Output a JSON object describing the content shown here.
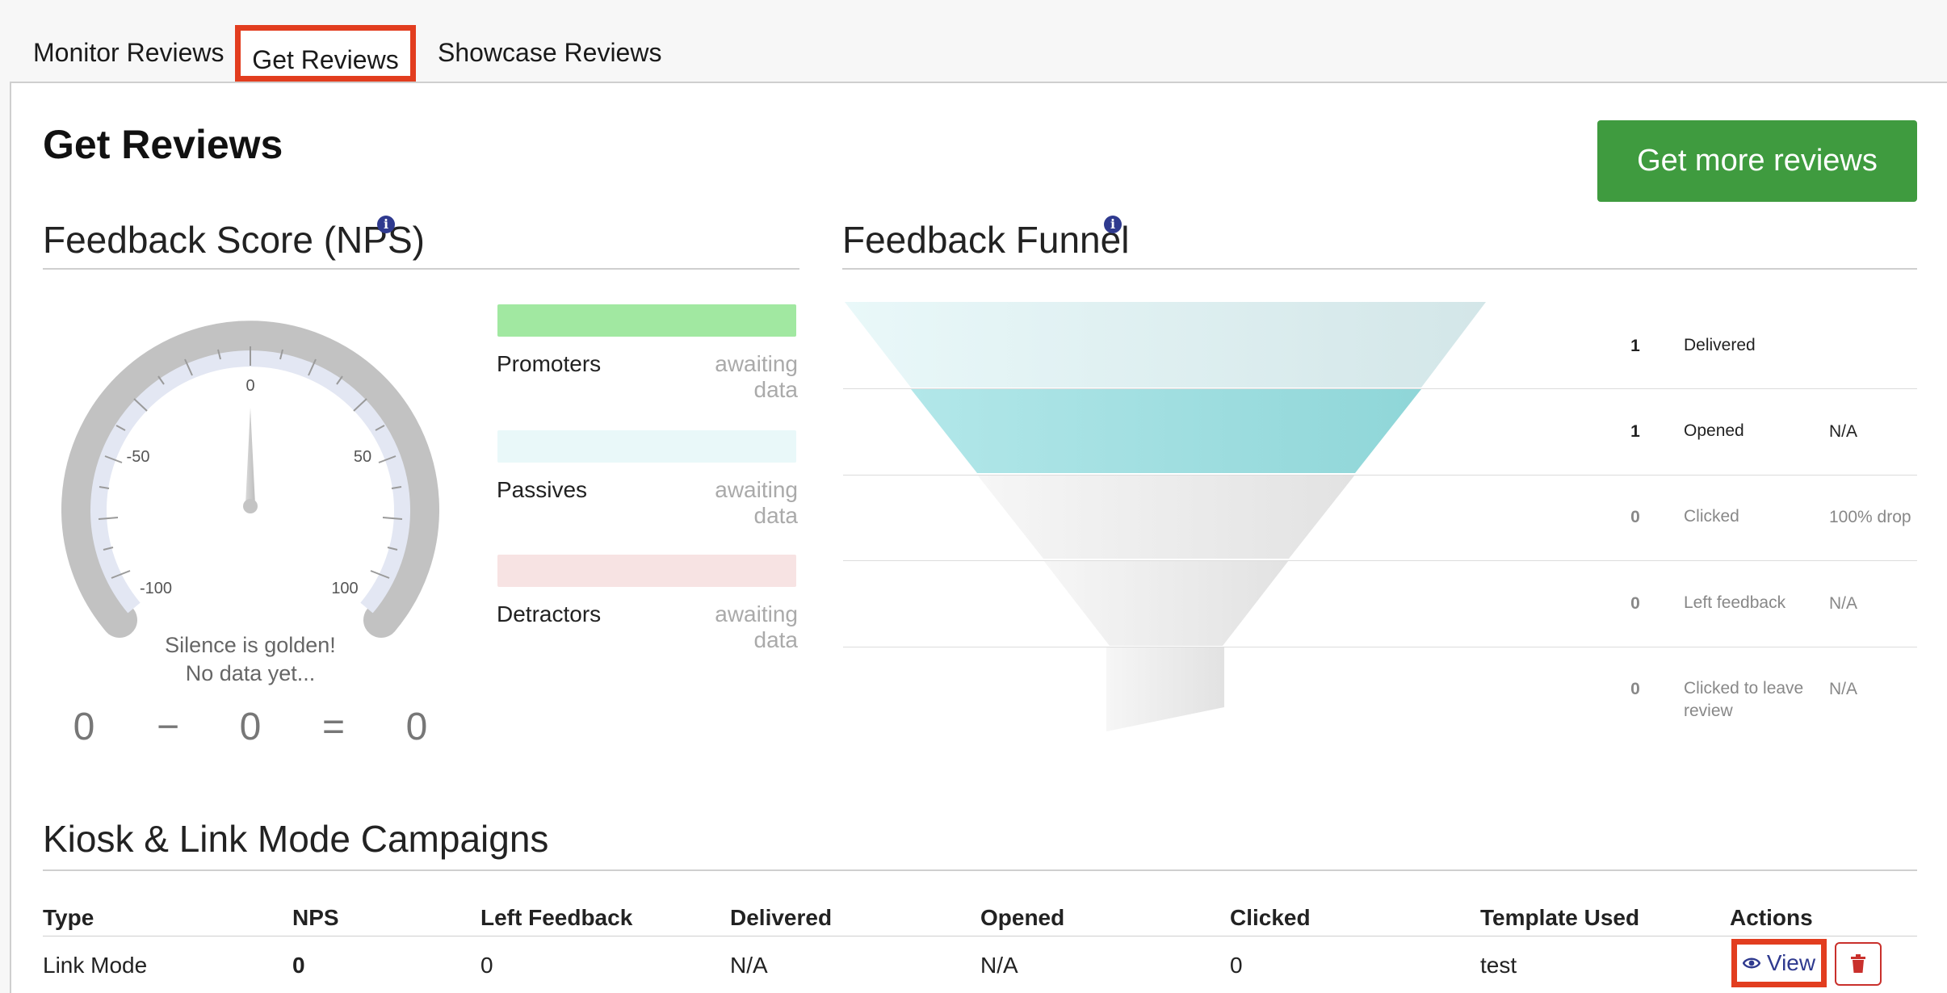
{
  "tabs": [
    {
      "label": "Monitor Reviews"
    },
    {
      "label": "Get Reviews"
    },
    {
      "label": "Showcase Reviews"
    }
  ],
  "page": {
    "title": "Get Reviews",
    "cta_label": "Get more reviews"
  },
  "nps": {
    "title": "Feedback Score (NPS)",
    "gauge_ticks": [
      "0",
      "-50",
      "50",
      "-100",
      "100"
    ],
    "empty_line1": "Silence is golden!",
    "empty_line2": "No data yet...",
    "equation": {
      "a": "0",
      "minus": "−",
      "b": "0",
      "equals": "=",
      "result": "0"
    },
    "legend": [
      {
        "label": "Promoters",
        "status": "awaiting data",
        "color": "#a1e8a1"
      },
      {
        "label": "Passives",
        "status": "awaiting data",
        "color": "#e9f8f9"
      },
      {
        "label": "Detractors",
        "status": "awaiting data",
        "color": "#f7e3e3"
      }
    ]
  },
  "funnel": {
    "title": "Feedback Funnel",
    "rows": [
      {
        "count": "1",
        "label": "Delivered",
        "pct": ""
      },
      {
        "count": "1",
        "label": "Opened",
        "pct": "N/A"
      },
      {
        "count": "0",
        "label": "Clicked",
        "pct": "100% drop"
      },
      {
        "count": "0",
        "label": "Left feedback",
        "pct": "N/A"
      },
      {
        "count": "0",
        "label_line1": "Clicked to leave",
        "label_line2": "review",
        "pct": "N/A"
      }
    ]
  },
  "campaigns": {
    "title": "Kiosk & Link Mode Campaigns",
    "headers": [
      "Type",
      "NPS",
      "Left Feedback",
      "Delivered",
      "Opened",
      "Clicked",
      "Template Used",
      "Actions"
    ],
    "rows": [
      {
        "type": "Link Mode",
        "nps": "0",
        "left_feedback": "0",
        "delivered": "N/A",
        "opened": "N/A",
        "clicked": "0",
        "template": "test",
        "view_label": "View"
      }
    ]
  },
  "icons": {
    "info": "info-icon",
    "view": "eye-icon",
    "delete": "trash-icon"
  },
  "colors": {
    "primary_green": "#3f9b3f",
    "highlight_red": "#e23d1f",
    "accent_blue": "#2f3a8f",
    "delete_red": "#c9302c"
  }
}
